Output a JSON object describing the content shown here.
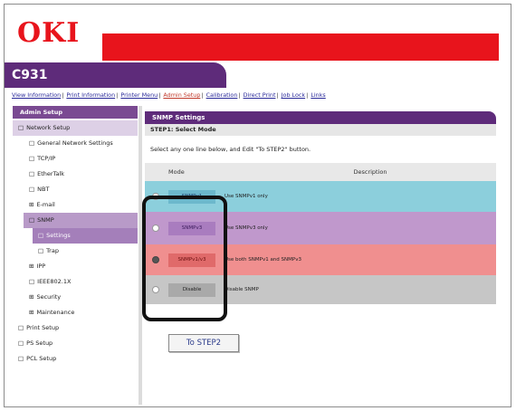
{
  "brand": {
    "logo": "OKI",
    "model": "C931"
  },
  "topnav": [
    {
      "label": "View Information",
      "active": false
    },
    {
      "label": "Print Information",
      "active": false
    },
    {
      "label": "Printer Menu",
      "active": false
    },
    {
      "label": "Admin Setup",
      "active": true
    },
    {
      "label": "Calibration",
      "active": false
    },
    {
      "label": "Direct Print",
      "active": false
    },
    {
      "label": "Job Lock",
      "active": false
    },
    {
      "label": "Links",
      "active": false
    }
  ],
  "sidebar": {
    "header": "Admin Setup",
    "items": [
      {
        "label": "Network Setup",
        "prefix": "□",
        "cls": "l1"
      },
      {
        "label": "General Network Settings",
        "prefix": "□",
        "cls": "sub"
      },
      {
        "label": "TCP/IP",
        "prefix": "□",
        "cls": "sub"
      },
      {
        "label": "EtherTalk",
        "prefix": "□",
        "cls": "sub"
      },
      {
        "label": "NBT",
        "prefix": "□",
        "cls": "sub"
      },
      {
        "label": "E-mail",
        "prefix": "⊞",
        "cls": "sub"
      },
      {
        "label": "SNMP",
        "prefix": "□",
        "cls": "sel"
      },
      {
        "label": "Settings",
        "prefix": "□",
        "cls": "sel2"
      },
      {
        "label": "Trap",
        "prefix": "□",
        "cls": "sub2"
      },
      {
        "label": "IPP",
        "prefix": "⊞",
        "cls": "sub"
      },
      {
        "label": "IEEE802.1X",
        "prefix": "□",
        "cls": "sub"
      },
      {
        "label": "Security",
        "prefix": "⊞",
        "cls": "sub"
      },
      {
        "label": "Maintenance",
        "prefix": "⊞",
        "cls": "sub"
      },
      {
        "label": "Print Setup",
        "prefix": "□",
        "cls": ""
      },
      {
        "label": "PS Setup",
        "prefix": "□",
        "cls": ""
      },
      {
        "label": "PCL Setup",
        "prefix": "□",
        "cls": ""
      }
    ]
  },
  "panel": {
    "title": "SNMP Settings",
    "step": "STEP1: Select Mode",
    "instruction": "Select any one line below, and Edit \"To STEP2\" button.",
    "col_mode": "Mode",
    "col_desc": "Description",
    "rows": [
      {
        "mode": "SNMPv1",
        "desc": "Use SNMPv1 only",
        "checked": false
      },
      {
        "mode": "SNMPv3",
        "desc": "Use SNMPv3 only",
        "checked": false
      },
      {
        "mode": "SNMPv1/v3",
        "desc": "Use both SNMPv1 and SNMPv3",
        "checked": true
      },
      {
        "mode": "Disable",
        "desc": "Disable SNMP",
        "checked": false
      }
    ],
    "next_button": "To STEP2"
  }
}
